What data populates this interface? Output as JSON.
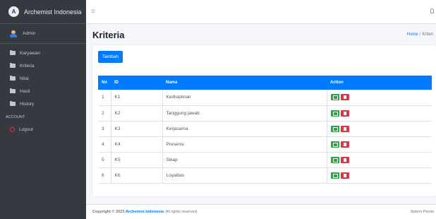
{
  "brand": {
    "name": "Archemist Indonesia",
    "logo_letter": "A"
  },
  "user": {
    "name": "Admin"
  },
  "sidebar": {
    "items": [
      {
        "label": "Karyawan",
        "icon": "folder-icon"
      },
      {
        "label": "Kriteria",
        "icon": "folder-icon"
      },
      {
        "label": "Nilai",
        "icon": "folder-icon"
      },
      {
        "label": "Hasil",
        "icon": "folder-icon"
      },
      {
        "label": "History",
        "icon": "folder-icon"
      }
    ],
    "account_header": "ACCOUNT",
    "logout_label": "Logout"
  },
  "topbar": {
    "menu_icon": "≡"
  },
  "header": {
    "title": "Kriteria",
    "breadcrumb": {
      "home": "Home",
      "separator": "/",
      "current": "Kriteri"
    }
  },
  "toolbar": {
    "add_label": "Tambah"
  },
  "table": {
    "headers": {
      "no": "No",
      "id": "ID",
      "nama": "Nama",
      "action": "Action"
    },
    "rows": [
      {
        "no": "1",
        "id": "K1",
        "nama": "Kedisiplinan"
      },
      {
        "no": "2",
        "id": "K2",
        "nama": "Tanggung jawab"
      },
      {
        "no": "3",
        "id": "K3",
        "nama": "Kerjasama"
      },
      {
        "no": "4",
        "id": "K4",
        "nama": "Presensi"
      },
      {
        "no": "5",
        "id": "K5",
        "nama": "Sikap"
      },
      {
        "no": "6",
        "id": "K6",
        "nama": "Loyalitas"
      }
    ]
  },
  "footer": {
    "copyright": "Copyright © 2023",
    "brand": "Archemist Indonesia.",
    "rights": "All rights reserved.",
    "right_text": "Sistem Penila"
  },
  "colors": {
    "primary": "#007bff",
    "sidebar": "#343a40",
    "success": "#28a745",
    "danger": "#dc3545"
  }
}
